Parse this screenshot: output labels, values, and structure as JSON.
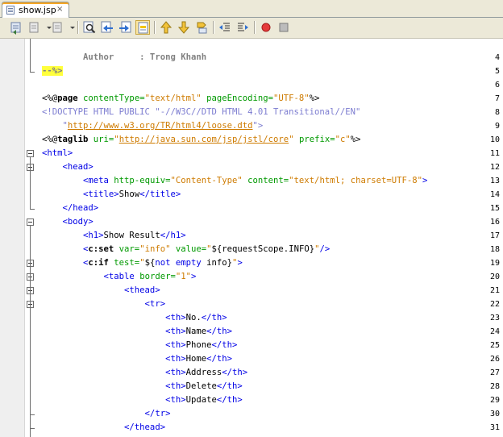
{
  "tab": {
    "label": "show.jsp",
    "close": "×"
  },
  "toolbar": {
    "buttons": [
      "back-icon",
      "last-edit-icon",
      "forward-icon",
      "find-icon",
      "find-previous-icon",
      "find-next-icon",
      "toggle-highlight-icon",
      "previous-bookmark-icon",
      "next-bookmark-icon",
      "toggle-bookmark-icon",
      "shift-left-icon",
      "shift-right-icon",
      "start-macro-icon",
      "stop-macro-icon"
    ],
    "active_button": "toggle-highlight-icon"
  },
  "editor": {
    "lines": [
      {
        "n": "4",
        "segs": [
          {
            "t": "        Author     : Trong Khanh",
            "c": "comment"
          }
        ]
      },
      {
        "n": "5",
        "segs": [
          {
            "t": "--%>",
            "c": "hl"
          }
        ]
      },
      {
        "n": "6",
        "segs": []
      },
      {
        "n": "7",
        "segs": [
          {
            "t": "<%@",
            "c": "el"
          },
          {
            "t": "page",
            "c": "dir"
          },
          {
            "t": " contentType=",
            "c": "attr"
          },
          {
            "t": "\"text/html\"",
            "c": "str"
          },
          {
            "t": " pageEncoding=",
            "c": "attr"
          },
          {
            "t": "\"UTF-8\"",
            "c": "str"
          },
          {
            "t": "%>",
            "c": "el"
          }
        ]
      },
      {
        "n": "8",
        "segs": [
          {
            "t": "<!DOCTYPE HTML PUBLIC \"-//W3C//DTD HTML 4.01 Transitional//EN\"",
            "c": "doc"
          }
        ]
      },
      {
        "n": "9",
        "segs": [
          {
            "t": "    \"",
            "c": "doc"
          },
          {
            "t": "http://www.w3.org/TR/html4/loose.dtd",
            "c": "url"
          },
          {
            "t": "\">",
            "c": "doc"
          }
        ]
      },
      {
        "n": "10",
        "segs": [
          {
            "t": "<%@",
            "c": "el"
          },
          {
            "t": "taglib",
            "c": "dir"
          },
          {
            "t": " uri=",
            "c": "attr"
          },
          {
            "t": "\"",
            "c": "str"
          },
          {
            "t": "http://java.sun.com/jsp/jstl/core",
            "c": "url"
          },
          {
            "t": "\"",
            "c": "str"
          },
          {
            "t": " prefix=",
            "c": "attr"
          },
          {
            "t": "\"c\"",
            "c": "str"
          },
          {
            "t": "%>",
            "c": "el"
          }
        ]
      },
      {
        "n": "11",
        "segs": [
          {
            "t": "<html>",
            "c": "tag"
          }
        ]
      },
      {
        "n": "12",
        "segs": [
          {
            "t": "    <head>",
            "c": "tag"
          }
        ]
      },
      {
        "n": "13",
        "segs": [
          {
            "t": "        <meta",
            "c": "tag"
          },
          {
            "t": " http-equiv=",
            "c": "attr"
          },
          {
            "t": "\"Content-Type\"",
            "c": "str"
          },
          {
            "t": " content=",
            "c": "attr"
          },
          {
            "t": "\"text/html; charset=UTF-8\"",
            "c": "str"
          },
          {
            "t": ">",
            "c": "tag"
          }
        ]
      },
      {
        "n": "14",
        "segs": [
          {
            "t": "        <title>",
            "c": "tag"
          },
          {
            "t": "Show",
            "c": "el"
          },
          {
            "t": "</title>",
            "c": "tag"
          }
        ]
      },
      {
        "n": "15",
        "segs": [
          {
            "t": "    </head>",
            "c": "tag"
          }
        ]
      },
      {
        "n": "16",
        "segs": [
          {
            "t": "    <body>",
            "c": "tag"
          }
        ]
      },
      {
        "n": "17",
        "segs": [
          {
            "t": "        <h1>",
            "c": "tag"
          },
          {
            "t": "Show Result",
            "c": "el"
          },
          {
            "t": "</h1>",
            "c": "tag"
          }
        ]
      },
      {
        "n": "18",
        "segs": [
          {
            "t": "        <",
            "c": "tag"
          },
          {
            "t": "c:set",
            "c": "dir"
          },
          {
            "t": " var=",
            "c": "attr"
          },
          {
            "t": "\"info\"",
            "c": "str"
          },
          {
            "t": " value=",
            "c": "attr"
          },
          {
            "t": "\"",
            "c": "str"
          },
          {
            "t": "${requestScope.INFO}",
            "c": "el"
          },
          {
            "t": "\"",
            "c": "str"
          },
          {
            "t": "/>",
            "c": "tag"
          }
        ]
      },
      {
        "n": "19",
        "segs": [
          {
            "t": "        <",
            "c": "tag"
          },
          {
            "t": "c:if",
            "c": "dir"
          },
          {
            "t": " test=",
            "c": "attr"
          },
          {
            "t": "\"",
            "c": "str"
          },
          {
            "t": "${",
            "c": "el"
          },
          {
            "t": "not empty",
            "c": "elk"
          },
          {
            "t": " info}",
            "c": "el"
          },
          {
            "t": "\"",
            "c": "str"
          },
          {
            "t": ">",
            "c": "tag"
          }
        ]
      },
      {
        "n": "20",
        "segs": [
          {
            "t": "            <table",
            "c": "tag"
          },
          {
            "t": " border=",
            "c": "attr"
          },
          {
            "t": "\"1\"",
            "c": "str"
          },
          {
            "t": ">",
            "c": "tag"
          }
        ]
      },
      {
        "n": "21",
        "segs": [
          {
            "t": "                <thead>",
            "c": "tag"
          }
        ]
      },
      {
        "n": "22",
        "segs": [
          {
            "t": "                    <tr>",
            "c": "tag"
          }
        ]
      },
      {
        "n": "23",
        "segs": [
          {
            "t": "                        <th>",
            "c": "tag"
          },
          {
            "t": "No.",
            "c": "el"
          },
          {
            "t": "</th>",
            "c": "tag"
          }
        ]
      },
      {
        "n": "24",
        "segs": [
          {
            "t": "                        <th>",
            "c": "tag"
          },
          {
            "t": "Name",
            "c": "el"
          },
          {
            "t": "</th>",
            "c": "tag"
          }
        ]
      },
      {
        "n": "25",
        "segs": [
          {
            "t": "                        <th>",
            "c": "tag"
          },
          {
            "t": "Phone",
            "c": "el"
          },
          {
            "t": "</th>",
            "c": "tag"
          }
        ]
      },
      {
        "n": "26",
        "segs": [
          {
            "t": "                        <th>",
            "c": "tag"
          },
          {
            "t": "Home",
            "c": "el"
          },
          {
            "t": "</th>",
            "c": "tag"
          }
        ]
      },
      {
        "n": "27",
        "segs": [
          {
            "t": "                        <th>",
            "c": "tag"
          },
          {
            "t": "Address",
            "c": "el"
          },
          {
            "t": "</th>",
            "c": "tag"
          }
        ]
      },
      {
        "n": "28",
        "segs": [
          {
            "t": "                        <th>",
            "c": "tag"
          },
          {
            "t": "Delete",
            "c": "el"
          },
          {
            "t": "</th>",
            "c": "tag"
          }
        ]
      },
      {
        "n": "29",
        "segs": [
          {
            "t": "                        <th>",
            "c": "tag"
          },
          {
            "t": "Update",
            "c": "el"
          },
          {
            "t": "</th>",
            "c": "tag"
          }
        ]
      },
      {
        "n": "30",
        "segs": [
          {
            "t": "                    </tr>",
            "c": "tag"
          }
        ]
      },
      {
        "n": "31",
        "segs": [
          {
            "t": "                </thead>",
            "c": "tag"
          }
        ]
      }
    ]
  }
}
